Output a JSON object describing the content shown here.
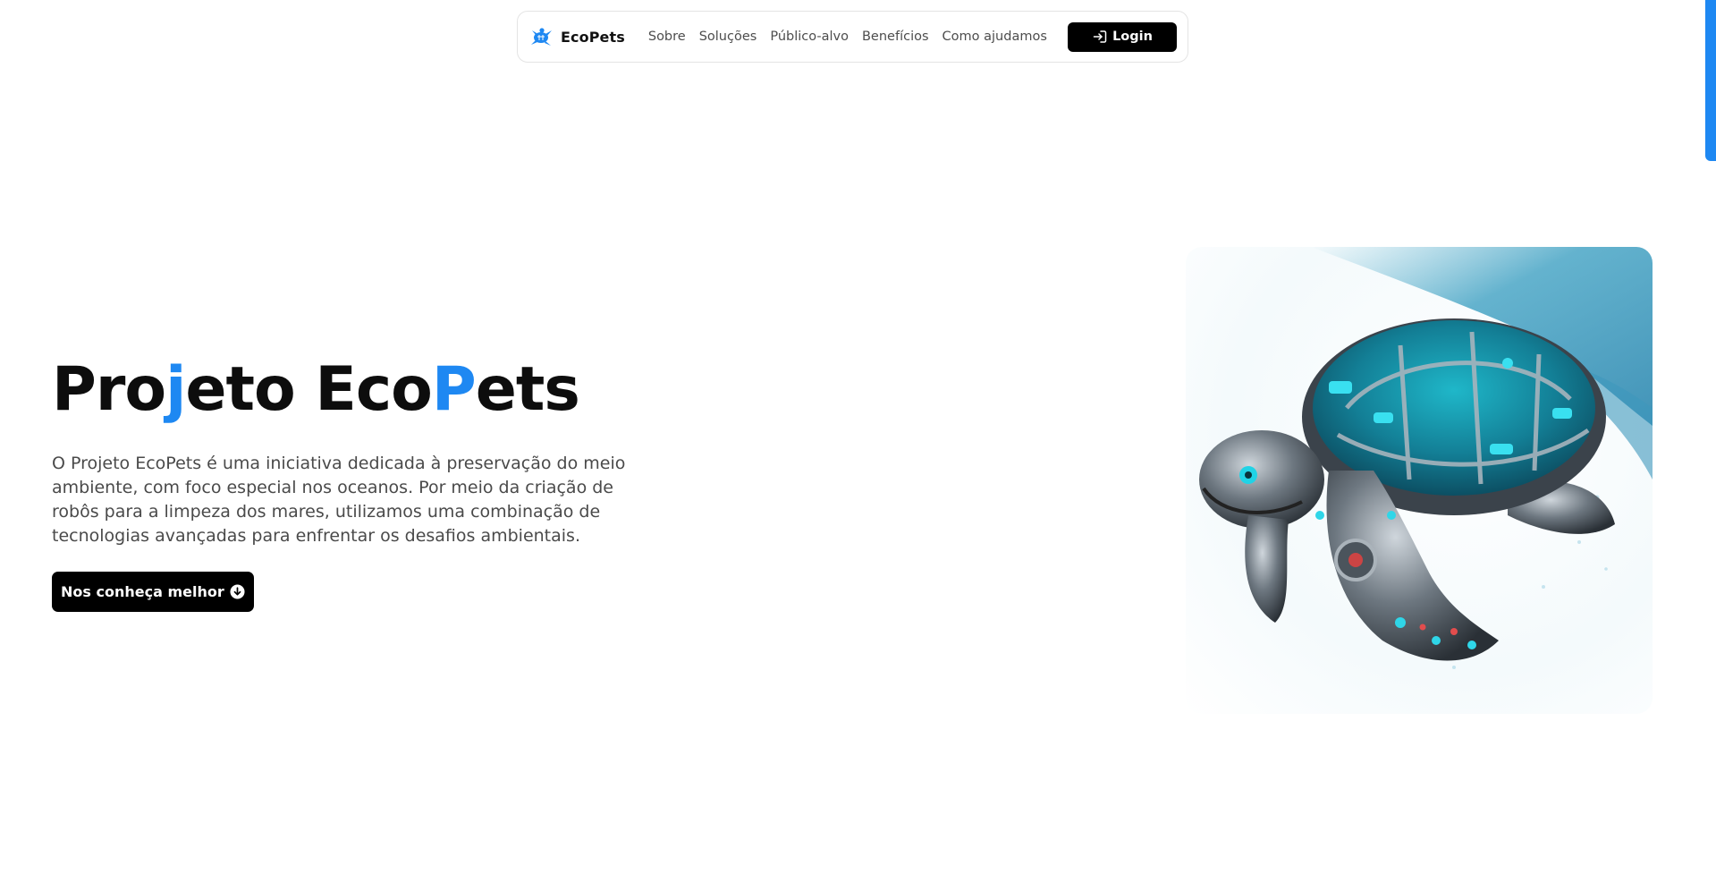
{
  "navbar": {
    "brand_name": "EcoPets",
    "brand_icon": "turtle-logo-icon",
    "links": [
      {
        "label": "Sobre"
      },
      {
        "label": "Soluções"
      },
      {
        "label": "Público-alvo"
      },
      {
        "label": "Benefícios"
      },
      {
        "label": "Como ajudamos"
      }
    ],
    "login_label": "Login",
    "login_icon": "login-icon"
  },
  "hero": {
    "title_parts": [
      "Pro",
      "j",
      "eto Eco",
      "P",
      "ets"
    ],
    "description": "O Projeto EcoPets é uma iniciativa dedicada à preservação do meio ambiente, com foco especial nos oceanos. Por meio da criação de robôs para a limpeza dos mares, utilizamos uma combinação de tecnologias avançadas para enfrentar os desafios ambientais.",
    "cta_label": "Nos conheça melhor",
    "cta_icon": "arrow-down-circle-icon",
    "image": "robotic-sea-turtle-image"
  },
  "colors": {
    "accent": "#1e88f2",
    "text_dark": "#0d0d0d",
    "text_muted": "#4a4a4a",
    "button_bg": "#000000",
    "button_text": "#ffffff"
  }
}
